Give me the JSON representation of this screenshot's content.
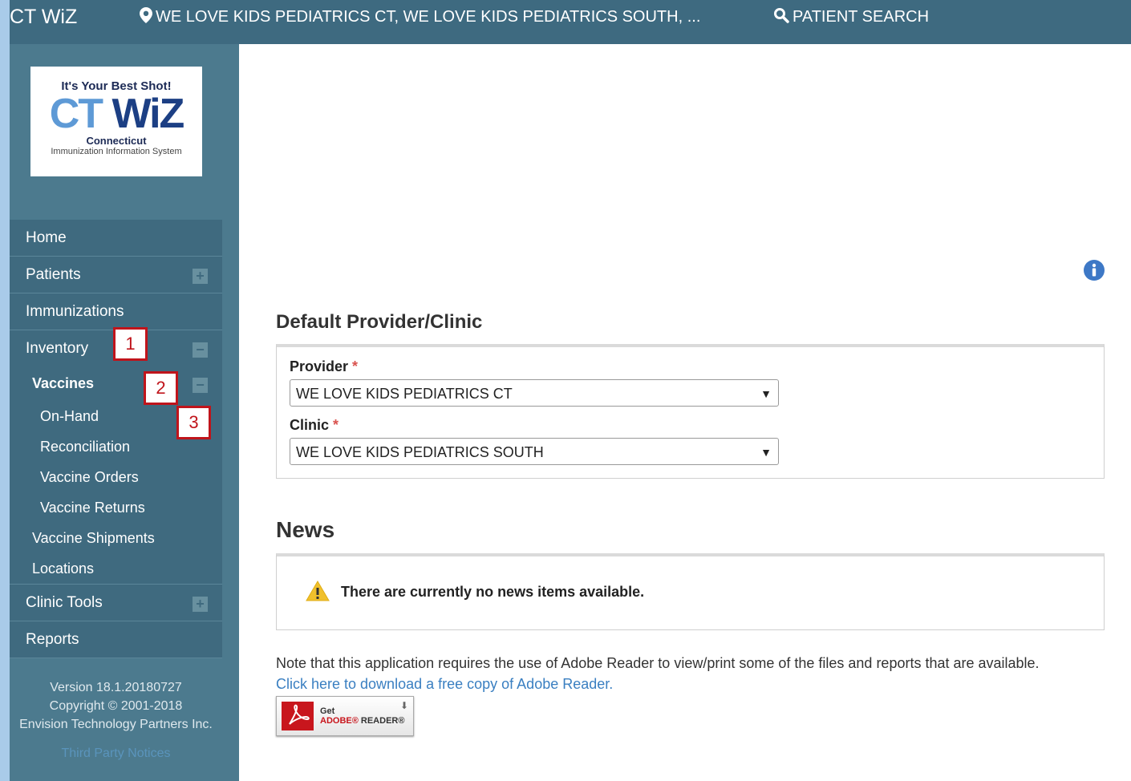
{
  "topbar": {
    "brand": "CT WiZ",
    "location": "WE LOVE KIDS PEDIATRICS CT, WE LOVE KIDS PEDIATRICS SOUTH, ...",
    "patient_search": "PATIENT SEARCH"
  },
  "logo": {
    "tagline": "It's Your Best Shot!",
    "main_ct": "CT",
    "main_wiz": "WiZ",
    "state": "Connecticut",
    "subtitle": "Immunization Information System"
  },
  "sidebar": {
    "home": "Home",
    "patients": "Patients",
    "immunizations": "Immunizations",
    "inventory": "Inventory",
    "vaccines": "Vaccines",
    "on_hand": "On-Hand",
    "reconciliation": "Reconciliation",
    "vaccine_orders": "Vaccine Orders",
    "vaccine_returns": "Vaccine Returns",
    "vaccine_shipments": "Vaccine Shipments",
    "locations": "Locations",
    "clinic_tools": "Clinic Tools",
    "reports": "Reports"
  },
  "callouts": {
    "c1": "1",
    "c2": "2",
    "c3": "3"
  },
  "footer": {
    "version": "Version 18.1.20180727",
    "copyright": "Copyright © 2001-2018",
    "company": "Envision Technology Partners Inc.",
    "third_party": "Third Party Notices"
  },
  "default_provider": {
    "heading": "Default Provider/Clinic",
    "provider_label": "Provider",
    "provider_value": "WE LOVE KIDS PEDIATRICS CT",
    "clinic_label": "Clinic",
    "clinic_value": "WE LOVE KIDS PEDIATRICS SOUTH",
    "required_mark": "*"
  },
  "news": {
    "heading": "News",
    "message": "There are currently no news items available."
  },
  "adobe": {
    "note": "Note that this application requires the use of Adobe Reader to view/print some of the files and reports that are available.",
    "link": "Click here to download a free copy of Adobe Reader.",
    "get": "Get",
    "adobe_word": "ADOBE®",
    "reader_word": "READER®"
  },
  "colors": {
    "topbar": "#3e6a80",
    "sidebar": "#4c7a8e",
    "callout_border": "#c0141b",
    "link": "#3a7fc1"
  },
  "icons": [
    "map-marker-icon",
    "search-icon",
    "plus-icon",
    "minus-icon",
    "info-icon",
    "warning-icon",
    "pdf-icon",
    "download-icon"
  ]
}
